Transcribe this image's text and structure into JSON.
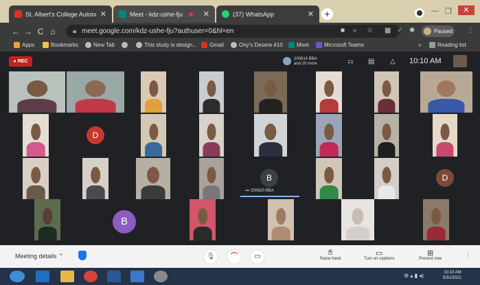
{
  "tabs": [
    {
      "label": "St. Albert's College Autonomous",
      "favicon_color": "#d93025"
    },
    {
      "label": "Meet - kdz-ushe-fju",
      "favicon_color": "#00897b"
    },
    {
      "label": "(37) WhatsApp",
      "favicon_color": "#25d366"
    }
  ],
  "toolbar": {
    "url": "meet.google.com/kdz-ushe-fju?authuser=0&hl=en",
    "profile_label": "Paused"
  },
  "bookmarks": [
    {
      "label": "Apps",
      "color": "#e8a23b"
    },
    {
      "label": "Bookmarks",
      "color": "#f5c542"
    },
    {
      "label": "New Tab",
      "color": "#bbbbbb"
    },
    {
      "label": "",
      "color": "#bbbbbb"
    },
    {
      "label": "This study is design...",
      "color": "#bbbbbb"
    },
    {
      "label": "Gmail",
      "color": "#d93025"
    },
    {
      "label": "Ony's Desere #10",
      "color": "#bbbbbb"
    },
    {
      "label": "Meet",
      "color": "#00897b"
    },
    {
      "label": "Microsoft Teams",
      "color": "#5b5fc7"
    }
  ],
  "reading_list": "Reading list",
  "meet": {
    "rec_label": "REC",
    "presenter_line1": "200614 BBA",
    "presenter_line2": "and 20 more",
    "time": "10:10 AM",
    "speaker_name": "200620 BBA"
  },
  "avatars": [
    {
      "letter": "D",
      "color": "#c5392e"
    },
    {
      "letter": "B",
      "color": "#3c4043"
    },
    {
      "letter": "D",
      "color": "#7a4a3a"
    },
    {
      "letter": "B",
      "color": "#8e5bc2"
    }
  ],
  "bottombar": {
    "meeting_details": "Meeting details",
    "raise_hand": "Raise hand",
    "captions": "Turn on captions",
    "present": "Present now"
  },
  "taskbar": {
    "time": "10:10 AM",
    "date": "5/31/2022"
  },
  "colors": {
    "tile_bg": "#202124",
    "accent": "#8ab4f8"
  }
}
